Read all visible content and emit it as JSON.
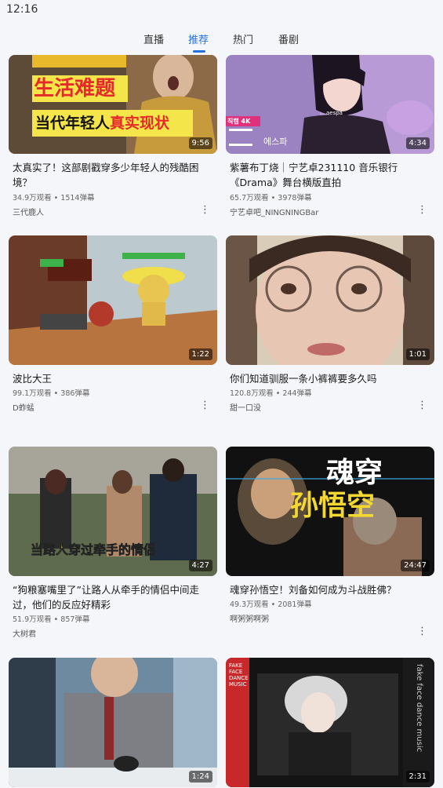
{
  "status_bar": {
    "time": "12:16"
  },
  "tabs": [
    {
      "label": "直播",
      "active": false
    },
    {
      "label": "推荐",
      "active": true
    },
    {
      "label": "热门",
      "active": false
    },
    {
      "label": "番剧",
      "active": false
    }
  ],
  "videos": [
    {
      "duration": "9:56",
      "thumb_text_1": "生活难题",
      "thumb_text_2": "当代年轻人",
      "thumb_text_3": "真实现状",
      "title": "太真实了！这部剧戳穿多少年轻人的残酷困境？",
      "stats": "34.9万观看 • 1514弹幕",
      "author": "三代鹿人"
    },
    {
      "duration": "4:34",
      "thumb_text_1": "aespa",
      "thumb_text_2": "직캠 4K",
      "thumb_text_3": "에스파",
      "title": "紫薯布丁烧｜宁艺卓231110 音乐银行《Drama》舞台横版直拍",
      "stats": "65.7万观看 • 3978弹幕",
      "author": "宁艺卓吧_NINGNINGBar"
    },
    {
      "duration": "1:22",
      "title": "波比大王",
      "stats": "99.1万观看 • 386弹幕",
      "author": "D蚱蜢"
    },
    {
      "duration": "1:01",
      "title": "你们知道驯服一条小裤裤要多久吗",
      "stats": "120.8万观看 • 244弹幕",
      "author": "甜一口没"
    },
    {
      "duration": "4:27",
      "thumb_text_1": "当路人穿过牵手的情侣",
      "title": "“狗粮塞嘴里了”让路人从牵手的情侣中间走过，他们的反应好精彩",
      "stats": "51.9万观看 • 857弹幕",
      "author": "大树君"
    },
    {
      "duration": "24:47",
      "thumb_text_1": "魂穿",
      "thumb_text_2": "孙悟空",
      "title": "魂穿孙悟空！刘备如何成为斗战胜佛？",
      "stats": "49.3万观看 • 2081弹幕",
      "author": "啊粥粥啊粥"
    },
    {
      "duration": "1:24"
    },
    {
      "duration": "2:31",
      "thumb_text_1": "fake face dance music",
      "thumb_text_2": "FAKE FACE DANCE MUSIC"
    }
  ],
  "colors": {
    "accent": "#2473d8",
    "background": "#f5f6f9"
  }
}
